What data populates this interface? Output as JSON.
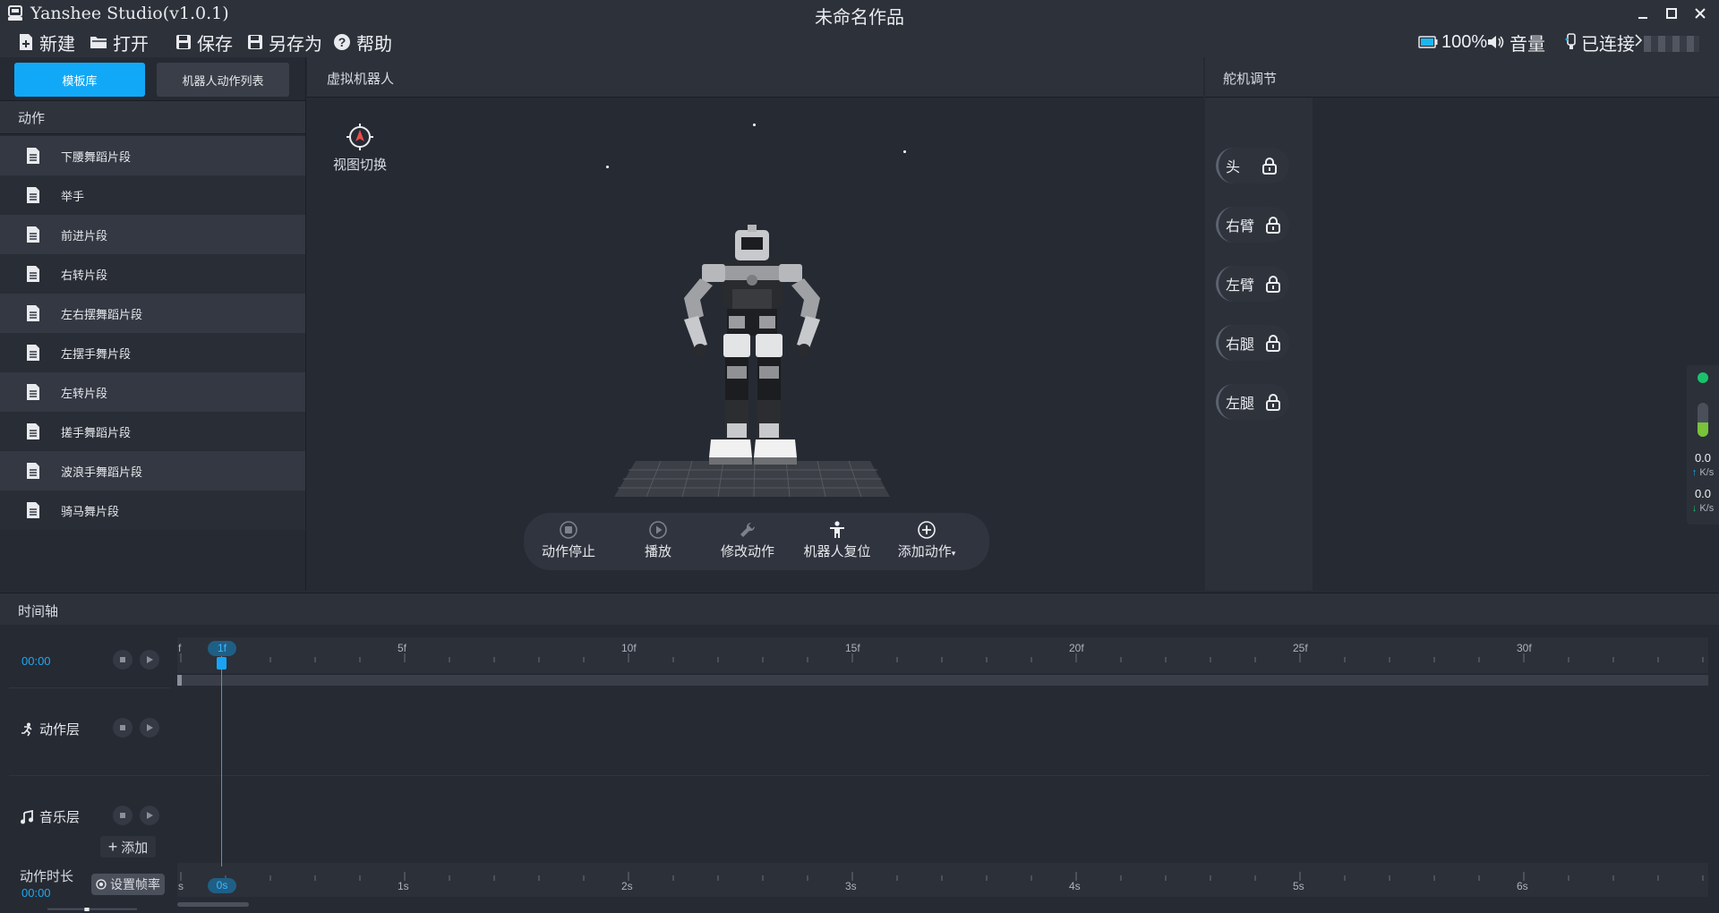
{
  "window": {
    "app_title": "Yanshee Studio(v1.0.1)",
    "doc_title": "未命名作品"
  },
  "toolbar": {
    "new": "新建",
    "open": "打开",
    "save": "保存",
    "save_as": "另存为",
    "help": "帮助"
  },
  "status": {
    "battery": "100%",
    "volume": "音量",
    "connection": "已连接"
  },
  "left_panel": {
    "tabs": [
      {
        "label": "模板库",
        "active": true
      },
      {
        "label": "机器人动作列表",
        "active": false
      }
    ],
    "section_title": "动作",
    "actions": [
      {
        "label": "下腰舞蹈片段"
      },
      {
        "label": "举手"
      },
      {
        "label": "前进片段"
      },
      {
        "label": "右转片段"
      },
      {
        "label": "左右摆舞蹈片段"
      },
      {
        "label": "左摆手舞片段"
      },
      {
        "label": "左转片段"
      },
      {
        "label": "搓手舞蹈片段"
      },
      {
        "label": "波浪手舞蹈片段"
      },
      {
        "label": "骑马舞片段"
      }
    ]
  },
  "center": {
    "title": "虚拟机器人",
    "view_switch": "视图切换",
    "controls": {
      "stop": "动作停止",
      "play": "播放",
      "edit": "修改动作",
      "reset": "机器人复位",
      "add": "添加动作"
    }
  },
  "right_panel": {
    "title": "舵机调节",
    "servos": [
      {
        "label": "头"
      },
      {
        "label": "右臂"
      },
      {
        "label": "左臂"
      },
      {
        "label": "右腿"
      },
      {
        "label": "左腿"
      }
    ]
  },
  "network": {
    "upload_value": "0.0",
    "upload_unit": "K/s",
    "download_value": "0.0",
    "download_unit": "K/s"
  },
  "timeline": {
    "title": "时间轴",
    "time": "00:00",
    "frame_ticks": [
      "f",
      "5f",
      "10f",
      "15f",
      "20f",
      "25f",
      "30f"
    ],
    "second_ticks": [
      "s",
      "1s",
      "2s",
      "3s",
      "4s",
      "5s",
      "6s"
    ],
    "playhead_frame": "1f",
    "playhead_second": "0s",
    "tracks": {
      "action": "动作层",
      "music": "音乐层"
    },
    "add_label": "添加",
    "duration_label": "动作时长",
    "duration_value": "00:00",
    "set_rate_label": "设置帧率"
  },
  "colors": {
    "accent": "#11a9f7",
    "background": "#262a33",
    "panel_header": "#2d313a",
    "time_text": "#21a8f2",
    "online_green": "#1ac36b"
  }
}
